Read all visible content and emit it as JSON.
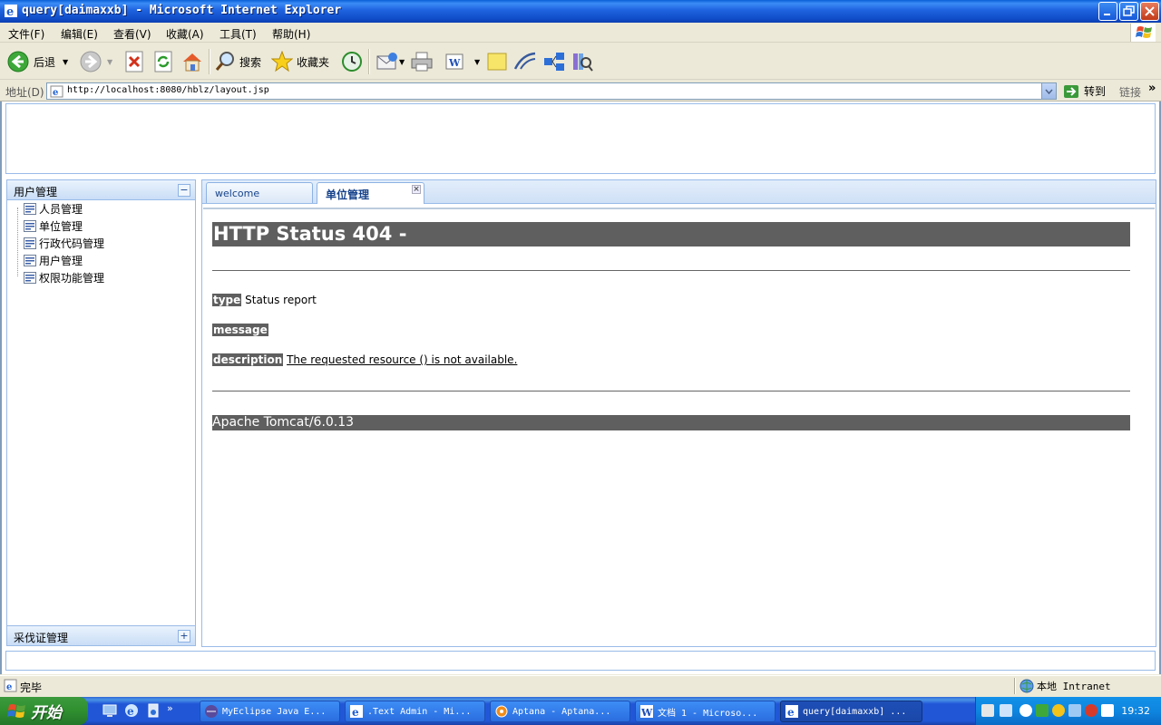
{
  "window": {
    "title": "query[daimaxxb] - Microsoft Internet Explorer"
  },
  "menu": {
    "items": [
      "文件(F)",
      "编辑(E)",
      "查看(V)",
      "收藏(A)",
      "工具(T)",
      "帮助(H)"
    ]
  },
  "toolbar": {
    "back_label": "后退",
    "search_label": "搜索",
    "favorites_label": "收藏夹"
  },
  "address": {
    "label": "地址(D)",
    "url": "http://localhost:8080/hblz/layout.jsp",
    "go_label": "转到",
    "links_label": "链接"
  },
  "west": {
    "panel1_title": "用户管理",
    "items": [
      "人员管理",
      "单位管理",
      "行政代码管理",
      "用户管理",
      "权限功能管理"
    ],
    "panel2_title": "采伐证管理"
  },
  "tabs": [
    {
      "label": "welcome"
    },
    {
      "label": "单位管理",
      "active": true
    }
  ],
  "error_page": {
    "heading": "HTTP Status 404 -",
    "type_label": "type",
    "type_value": "Status report",
    "message_label": "message",
    "description_label": "description",
    "description_value": "The requested resource () is not available.",
    "server": "Apache Tomcat/6.0.13"
  },
  "status": {
    "text": "完毕",
    "zone": "本地 Intranet"
  },
  "taskbar": {
    "start_label": "开始",
    "tasks": [
      "MyEclipse Java E...",
      ".Text Admin - Mi...",
      "Aptana - Aptana...",
      "文档 1 - Microso...",
      "query[daimaxxb] ..."
    ],
    "clock": "19:32"
  },
  "colors": {
    "xp_blue": "#0f4bc6",
    "panel_border": "#99bbe8",
    "tomcat_bar": "#5f5f5f",
    "start_green": "#2f8f2f"
  }
}
